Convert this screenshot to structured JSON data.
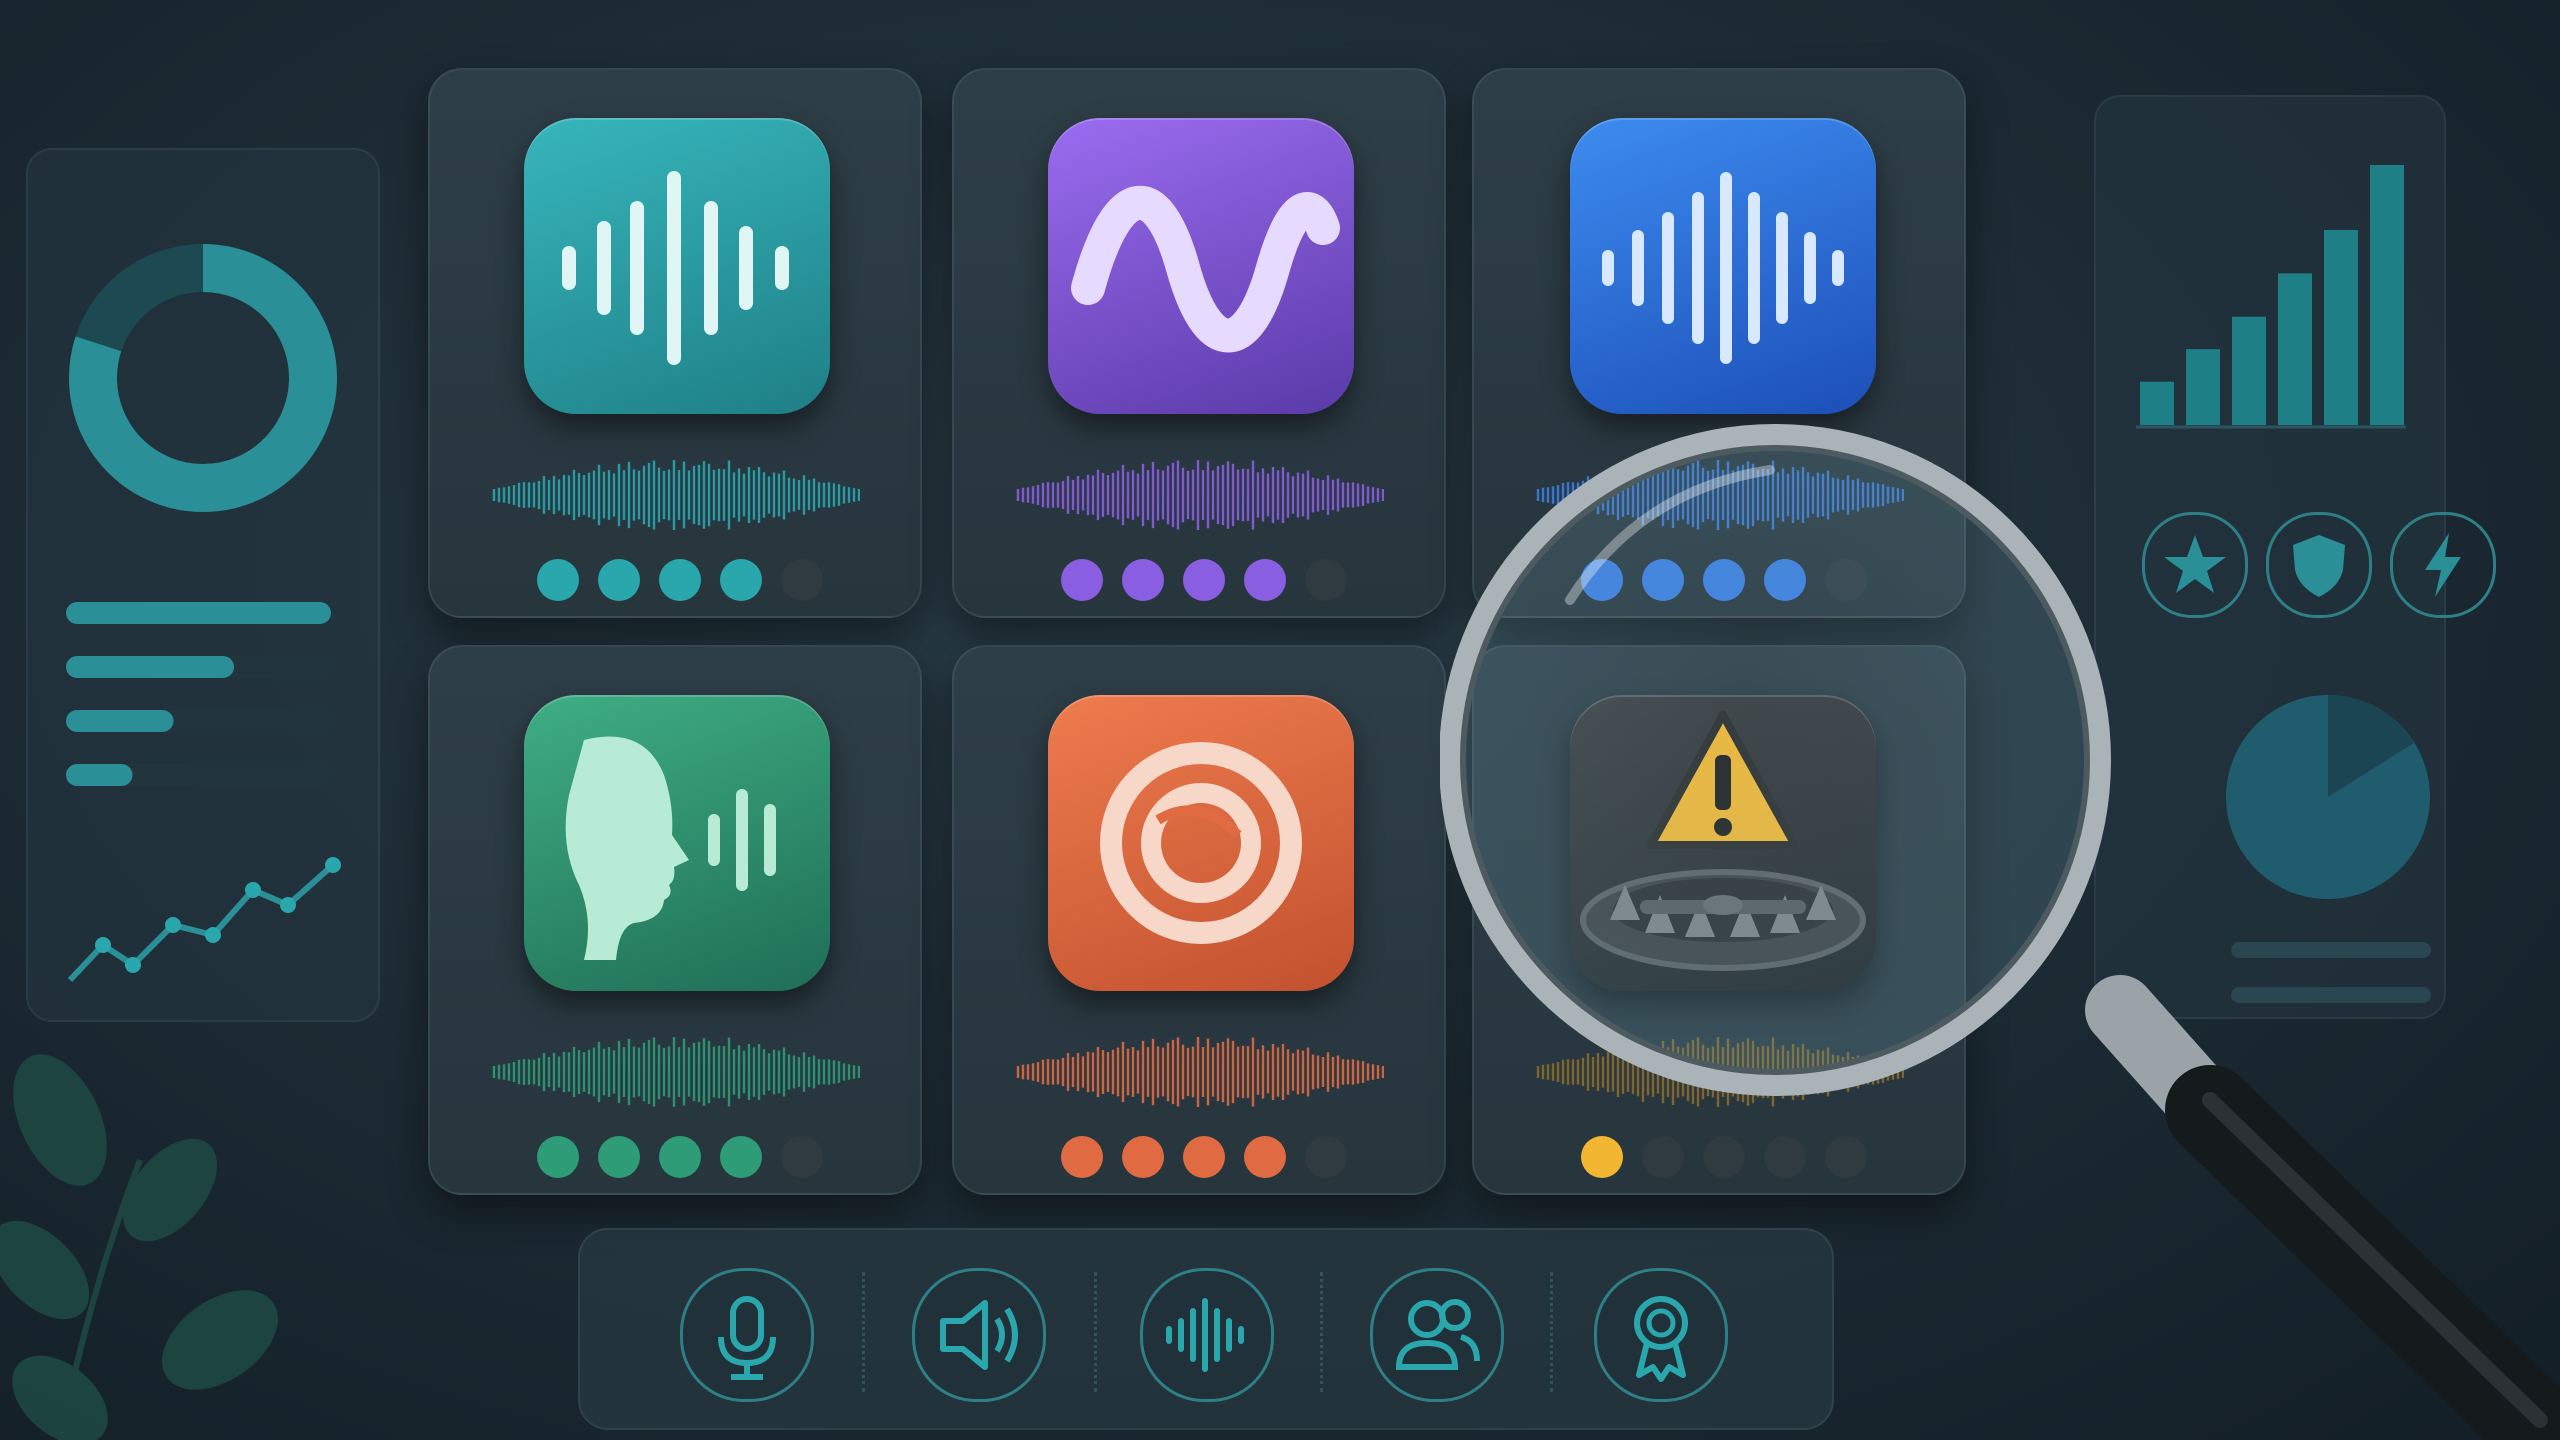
{
  "colors": {
    "background": "#1c2a33",
    "teal": "#2aa6ad",
    "purple": "#8a5ee0",
    "blue": "#3a7de0",
    "green": "#2e9c76",
    "orange": "#e06a42",
    "warning": "#f2b632"
  },
  "apps": [
    {
      "icon": "soundwave-icon",
      "color": "#2aa6ad",
      "rating_filled": 4,
      "rating_total": 5
    },
    {
      "icon": "sine-wave-icon",
      "color": "#8a5ee0",
      "rating_filled": 4,
      "rating_total": 5
    },
    {
      "icon": "soundwave-icon",
      "color": "#3a7de0",
      "rating_filled": 4,
      "rating_total": 5
    },
    {
      "icon": "speaking-head-icon",
      "color": "#2e9c76",
      "rating_filled": 4,
      "rating_total": 5
    },
    {
      "icon": "ring-logo-icon",
      "color": "#e06a42",
      "rating_filled": 4,
      "rating_total": 5
    },
    {
      "icon": "warning-trap-icon",
      "color": "#f2b632",
      "rating_filled": 1,
      "rating_total": 5
    }
  ],
  "left_panel": {
    "donut_fraction": 0.8,
    "progress_bars": [
      1.0,
      0.7,
      0.5,
      0.35
    ]
  },
  "right_panel": {
    "bar_values": [
      2,
      3.5,
      5,
      7,
      9,
      12
    ],
    "badges": [
      "star-icon",
      "shield-icon",
      "lightning-icon"
    ],
    "pie_fraction": 0.85
  },
  "toolbar": {
    "items": [
      "microphone-icon",
      "speaker-icon",
      "soundwave-icon",
      "users-icon",
      "award-icon"
    ]
  }
}
